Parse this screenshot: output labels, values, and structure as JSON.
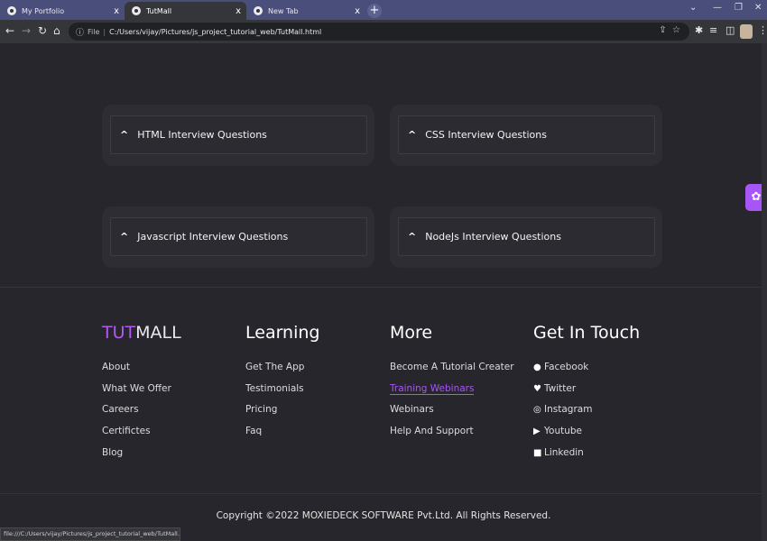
{
  "browser": {
    "tabs": [
      {
        "label": "My Portfolio"
      },
      {
        "label": "TutMall"
      },
      {
        "label": "New Tab"
      }
    ],
    "tab_close": "x",
    "new_tab": "+",
    "address_scheme": "File",
    "address_url": "C:/Users/vijay/Pictures/js_project_tutorial_web/TutMall.html",
    "status_url": "file:///C:/Users/vijay/Pictures/js_project_tutorial_web/TutMall.html"
  },
  "accordions": [
    {
      "label": "HTML Interview Questions"
    },
    {
      "label": "CSS Interview Questions"
    },
    {
      "label": "Javascript Interview Questions"
    },
    {
      "label": "NodeJs Interview Questions"
    }
  ],
  "footer": {
    "brand_part1": "TUT",
    "brand_part2": "MALL",
    "brand_links": [
      "About",
      "What We Offer",
      "Careers",
      "Certifictes",
      "Blog"
    ],
    "learning": {
      "title": "Learning",
      "links": [
        "Get The App",
        "Testimonials",
        "Pricing",
        "Faq"
      ]
    },
    "more": {
      "title": "More",
      "links": [
        "Become A Tutorial Creater",
        "Training Webinars",
        "Webinars",
        "Help And Support"
      ]
    },
    "contact": {
      "title": "Get In Touch",
      "links": [
        "Facebook",
        "Twitter",
        "Instagram",
        "Youtube",
        "Linkedin"
      ]
    },
    "copyright": "Copyright ©2022 MOXIEDECK SOFTWARE Pvt.Ltd. All Rights Reserved."
  },
  "colors": {
    "accent": "#a855f7",
    "background": "#27262d",
    "card": "#2e2d34"
  },
  "icons": {
    "settings": "gear-icon",
    "accordion": "chevron-up-icon"
  }
}
